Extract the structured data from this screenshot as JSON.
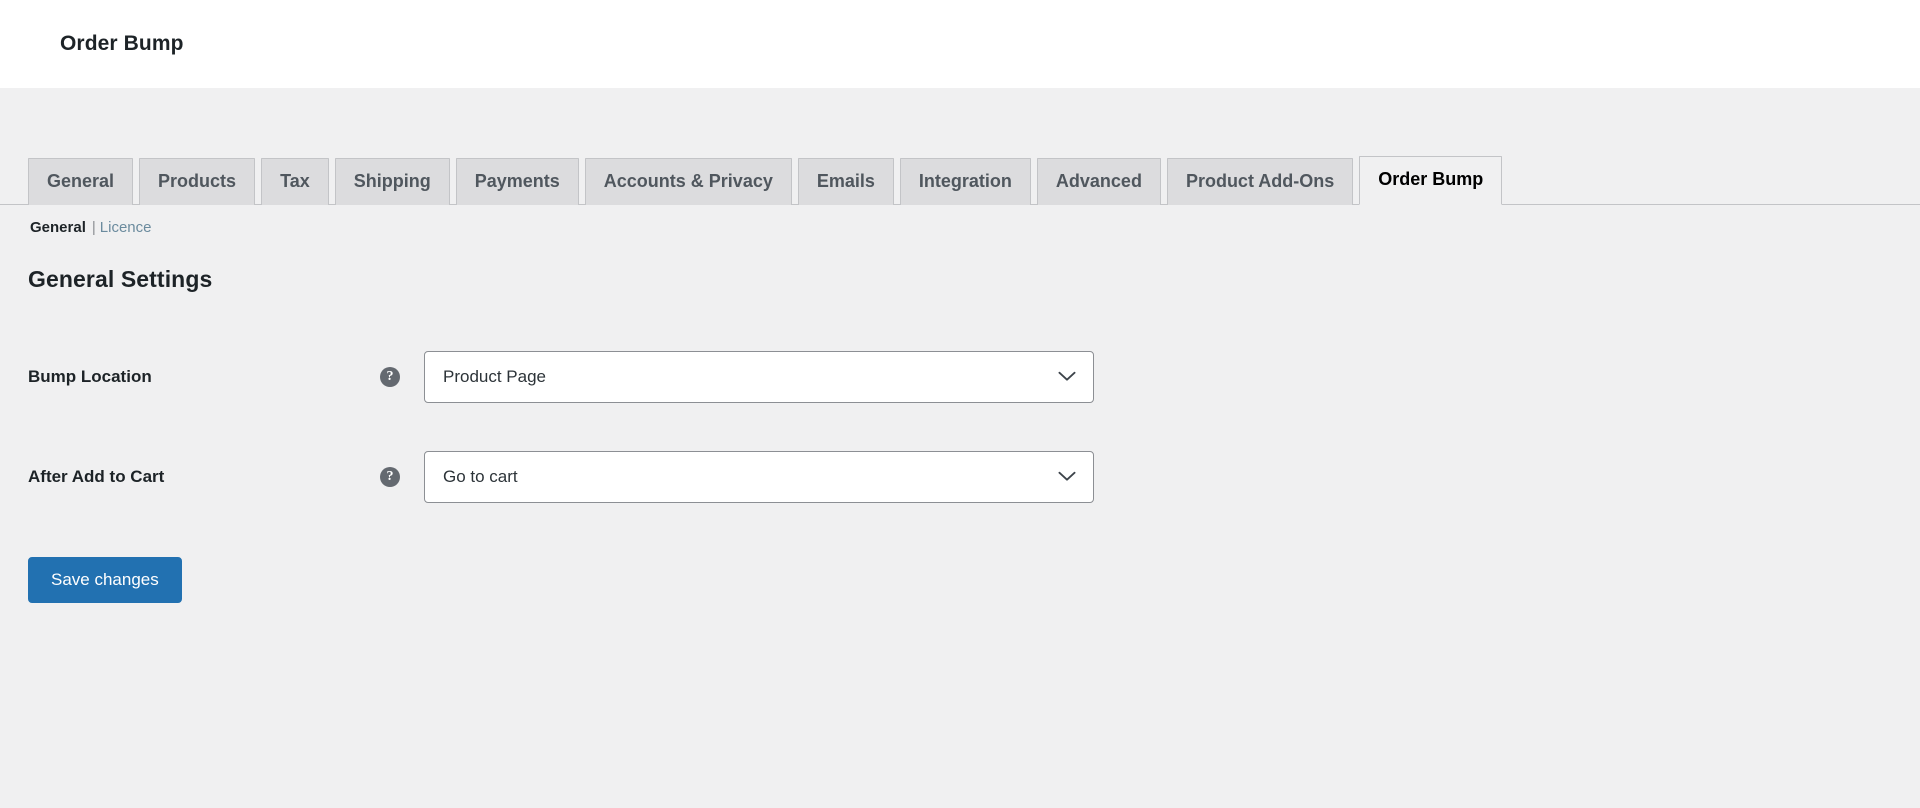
{
  "header": {
    "title": "Order Bump"
  },
  "tabs": [
    {
      "label": "General",
      "active": false
    },
    {
      "label": "Products",
      "active": false
    },
    {
      "label": "Tax",
      "active": false
    },
    {
      "label": "Shipping",
      "active": false
    },
    {
      "label": "Payments",
      "active": false
    },
    {
      "label": "Accounts & Privacy",
      "active": false
    },
    {
      "label": "Emails",
      "active": false
    },
    {
      "label": "Integration",
      "active": false
    },
    {
      "label": "Advanced",
      "active": false
    },
    {
      "label": "Product Add-Ons",
      "active": false
    },
    {
      "label": "Order Bump",
      "active": true
    }
  ],
  "subnav": {
    "items": [
      {
        "label": "General",
        "current": true
      },
      {
        "label": "Licence",
        "current": false
      }
    ],
    "separator": "|"
  },
  "section": {
    "title": "General Settings"
  },
  "fields": [
    {
      "label": "Bump Location",
      "help_icon": "help-tip-icon",
      "help_glyph": "?",
      "value": "Product Page",
      "options": [
        "Product Page"
      ]
    },
    {
      "label": "After Add to Cart",
      "help_icon": "help-tip-icon",
      "help_glyph": "?",
      "value": "Go to cart",
      "options": [
        "Go to cart"
      ]
    }
  ],
  "submit": {
    "label": "Save changes"
  },
  "colors": {
    "accent": "#2271b1",
    "page_background": "#f0f0f1",
    "tab_background": "#dcdcde",
    "link": "#6b8b9e",
    "text": "#1d2327"
  }
}
